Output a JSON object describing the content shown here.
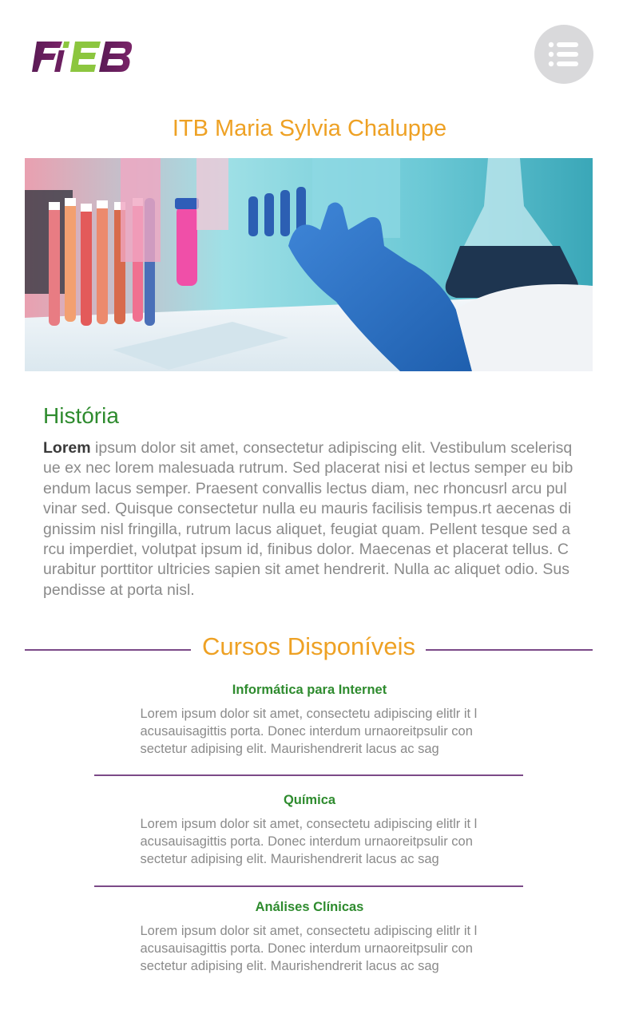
{
  "header": {
    "logo_text": "FIEB",
    "menu_icon": "menu-icon"
  },
  "site_title": "ITB Maria Sylvia Chaluppe",
  "hero": {
    "icon": "laboratory-image"
  },
  "history": {
    "heading": "História",
    "lead_word": "Lorem",
    "body": " ipsum dolor sit amet, consectetur adipiscing elit. Vestibulum scelerisque ex nec lorem malesuada rutrum. Sed placerat nisi et lectus semper eu bibendum lacus semper. Praesent convallis lectus diam, nec rhoncusrl arcu pulvinar sed. Quisque consectetur nulla eu mauris facilisis tempus.rt aecenas dignissim nisl fringilla, rutrum lacus aliquet, feugiat quam. Pellent tesque sed arcu imperdiet, volutpat ipsum id, finibus dolor. Maecenas et placerat tellus. Curabitur porttitor ultricies sapien sit amet hendrerit. Nulla ac aliquet odio. Suspendisse at porta nisl."
  },
  "courses": {
    "heading": "Cursos Disponíveis",
    "items": [
      {
        "name": "Informática para Internet",
        "description": "Lorem ipsum dolor sit amet, consectetu adipiscing elitlr it lacusauisagittis porta. Donec interdum urnaoreitpsulir consectetur  adipising elit. Maurishendrerit lacus ac sag"
      },
      {
        "name": "Química",
        "description": "Lorem ipsum dolor sit amet, consectetu adipiscing elitlr it lacusauisagittis porta. Donec interdum urnaoreitpsulir consectetur  adipising elit. Maurishendrerit lacus ac sag"
      },
      {
        "name": "Análises Clínicas",
        "description": "Lorem ipsum dolor sit amet, consectetu adipiscing elitlr it lacusauisagittis porta. Donec interdum urnaoreitpsulir consectetur  adipising elit. Maurishendrerit lacus ac sag"
      }
    ]
  },
  "colors": {
    "accent_orange": "#eea124",
    "heading_green": "#2e8b2e",
    "divider_purple": "#7b4a88",
    "logo_purple": "#6b1f5f",
    "logo_green": "#8cc63f"
  }
}
